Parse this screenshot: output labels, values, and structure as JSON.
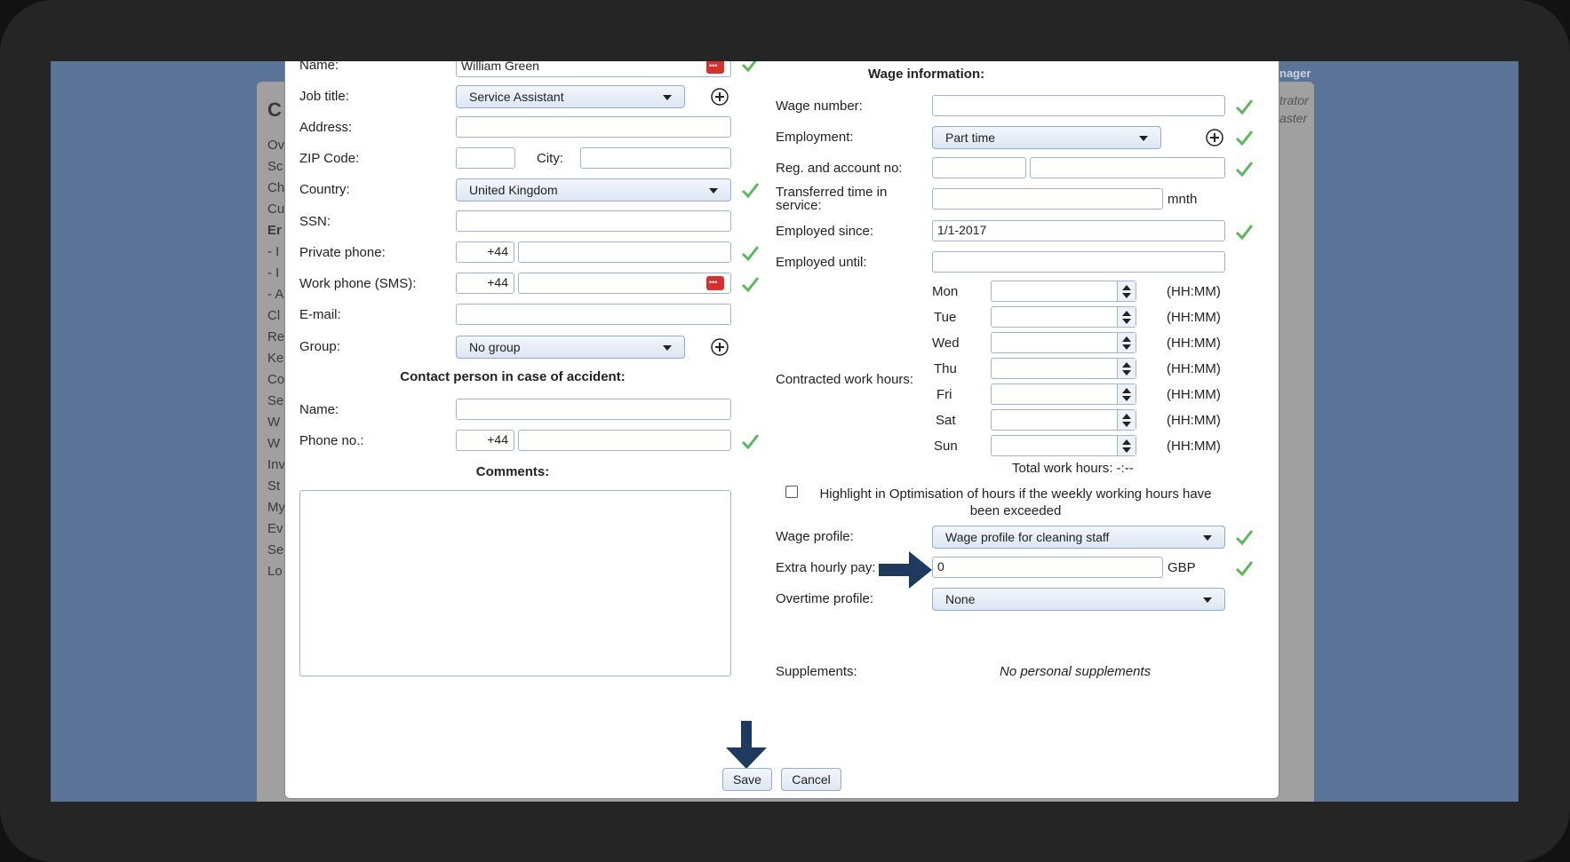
{
  "background": {
    "letters": [
      "C",
      "Ov",
      "Sc",
      "Ch",
      "Cu",
      "Er",
      "- I",
      "- I",
      "- A",
      "Cl",
      "Re",
      "Ke",
      "Co",
      "Se",
      "W",
      "W",
      "Inv",
      "St",
      "My",
      "Ev",
      "Se",
      "Lo"
    ],
    "top_right": "nager",
    "right_1": "trator",
    "right_2": "aster"
  },
  "left": {
    "name_label": "Name:",
    "name_value": "William Green",
    "job_title_label": "Job title:",
    "job_title_value": "Service Assistant",
    "address_label": "Address:",
    "zip_label": "ZIP Code:",
    "city_label": "City:",
    "country_label": "Country:",
    "country_value": "United Kingdom",
    "ssn_label": "SSN:",
    "private_phone_label": "Private phone:",
    "private_phone_prefix": "+44",
    "work_phone_label": "Work phone (SMS):",
    "work_phone_prefix": "+44",
    "email_label": "E-mail:",
    "group_label": "Group:",
    "group_value": "No group",
    "contact_heading": "Contact person in case of accident:",
    "contact_name_label": "Name:",
    "contact_phone_label": "Phone no.:",
    "contact_phone_prefix": "+44",
    "comments_heading": "Comments:"
  },
  "right": {
    "heading": "Wage information:",
    "wage_number_label": "Wage number:",
    "employment_label": "Employment:",
    "employment_value": "Part time",
    "reg_account_label": "Reg. and account no:",
    "transferred_label_1": "Transferred time in",
    "transferred_label_2": "service:",
    "transferred_unit": "mnth",
    "employed_since_label": "Employed since:",
    "employed_since_value": "1/1-2017",
    "employed_until_label": "Employed until:",
    "contracted_label": "Contracted work hours:",
    "days": [
      {
        "day": "Mon",
        "unit": "(HH:MM)"
      },
      {
        "day": "Tue",
        "unit": "(HH:MM)"
      },
      {
        "day": "Wed",
        "unit": "(HH:MM)"
      },
      {
        "day": "Thu",
        "unit": "(HH:MM)"
      },
      {
        "day": "Fri",
        "unit": "(HH:MM)"
      },
      {
        "day": "Sat",
        "unit": "(HH:MM)"
      },
      {
        "day": "Sun",
        "unit": "(HH:MM)"
      }
    ],
    "total_hours": "Total work hours: -:--",
    "highlight_text_1": "Highlight in Optimisation of hours if the weekly working hours have",
    "highlight_text_2": "been exceeded",
    "wage_profile_label": "Wage profile:",
    "wage_profile_value": "Wage profile for cleaning staff",
    "extra_pay_label": "Extra hourly pay:",
    "extra_pay_value": "0",
    "extra_pay_unit": "GBP",
    "overtime_label": "Overtime profile:",
    "overtime_value": "None",
    "supplements_label": "Supplements:",
    "supplements_value": "No personal supplements"
  },
  "buttons": {
    "save": "Save",
    "cancel": "Cancel"
  },
  "colors": {
    "check": "#5cb85c",
    "arrow": "#1f3a5f",
    "screen_bg": "#5b7396"
  }
}
